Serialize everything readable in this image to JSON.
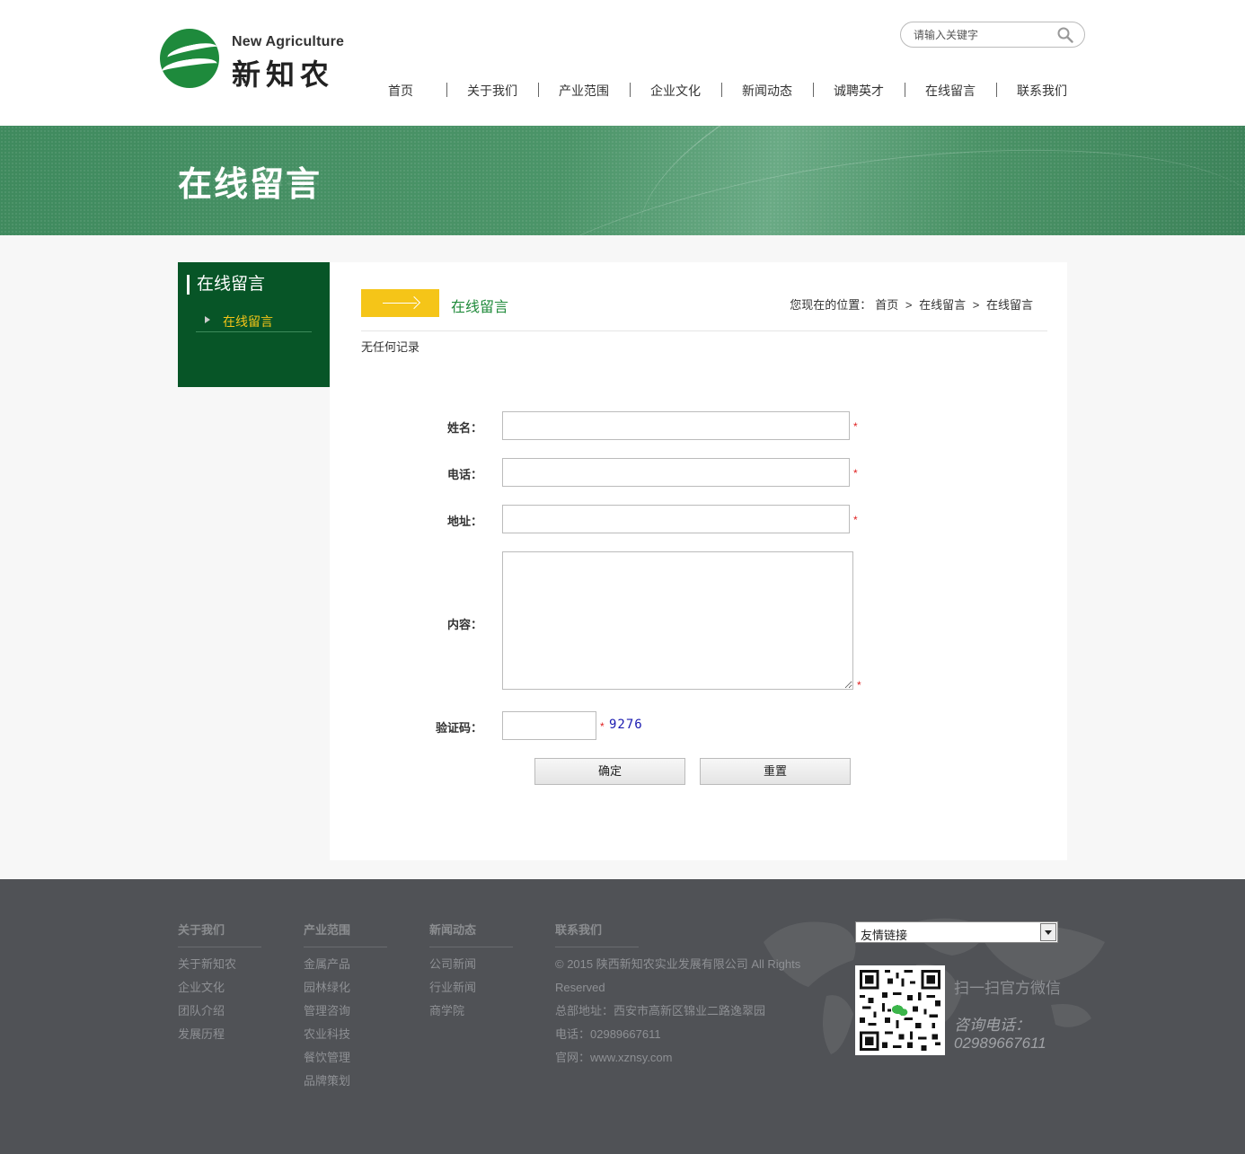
{
  "header": {
    "logo_en": "New Agriculture",
    "logo_cn": "新知农",
    "search_placeholder": "请输入关键字",
    "nav": [
      "首页",
      "关于我们",
      "产业范围",
      "企业文化",
      "新闻动态",
      "诚聘英才",
      "在线留言",
      "联系我们"
    ]
  },
  "banner": {
    "title": "在线留言"
  },
  "sidebar": {
    "title": "在线留言",
    "items": [
      {
        "label": "在线留言"
      }
    ]
  },
  "main": {
    "section_title": "在线留言",
    "breadcrumb": {
      "prefix": "您现在的位置：",
      "items": [
        "首页",
        "在线留言",
        "在线留言"
      ],
      "sep": ">"
    },
    "no_record": "无任何记录",
    "form": {
      "name_label": "姓名：",
      "phone_label": "电话：",
      "address_label": "地址：",
      "content_label": "内容：",
      "captcha_label": "验证码：",
      "captcha_code": "9276",
      "required_mark": "*",
      "submit_label": "确定",
      "reset_label": "重置"
    }
  },
  "footer": {
    "columns": [
      {
        "head": "关于我们",
        "links": [
          "关于新知农",
          "企业文化",
          "团队介绍",
          "发展历程"
        ]
      },
      {
        "head": "产业范围",
        "links": [
          "金属产品",
          "园林绿化",
          "管理咨询",
          "农业科技",
          "餐饮管理",
          "品牌策划"
        ]
      },
      {
        "head": "新闻动态",
        "links": [
          "公司新闻",
          "行业新闻",
          "商学院"
        ]
      }
    ],
    "contact": {
      "head": "联系我们",
      "lines": [
        "© 2015 陕西新知农实业发展有限公司 All Rights",
        "Reserved",
        "总部地址：西安市高新区锦业二路逸翠园",
        "电话：02989667611",
        "官网：www.xznsy.com"
      ]
    },
    "links_select": "友情链接",
    "qr_text": "扫一扫官方微信",
    "tel_label": "咨询电话：",
    "tel_number": "02989667611"
  },
  "colors": {
    "brand_green": "#075527",
    "accent_yellow": "#f5c518",
    "title_green": "#1f8a3a",
    "footer_bg": "#505256"
  }
}
